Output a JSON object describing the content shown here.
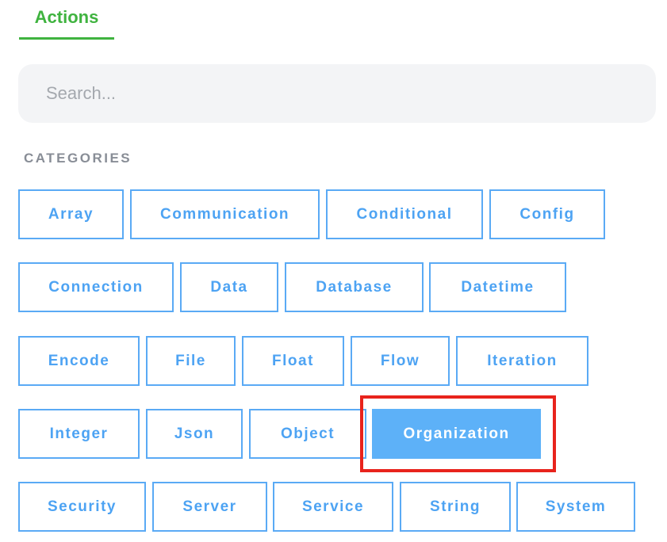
{
  "tab": {
    "label": "Actions"
  },
  "search": {
    "placeholder": "Search..."
  },
  "categories_label": "CATEGORIES",
  "categories": [
    "Array",
    "Communication",
    "Conditional",
    "Config",
    "Connection",
    "Data",
    "Database",
    "Datetime",
    "Encode",
    "File",
    "Float",
    "Flow",
    "Iteration",
    "Integer",
    "Json",
    "Object",
    "Organization",
    "Security",
    "Server",
    "Service",
    "String",
    "System"
  ],
  "selected_category": "Organization",
  "colors": {
    "tab_accent": "#3fb33f",
    "category_border": "#5aaaf5",
    "category_text": "#4da3f3",
    "selected_fill": "#5db1f8",
    "highlight_box": "#e8231c",
    "search_bg": "#f3f4f6"
  }
}
